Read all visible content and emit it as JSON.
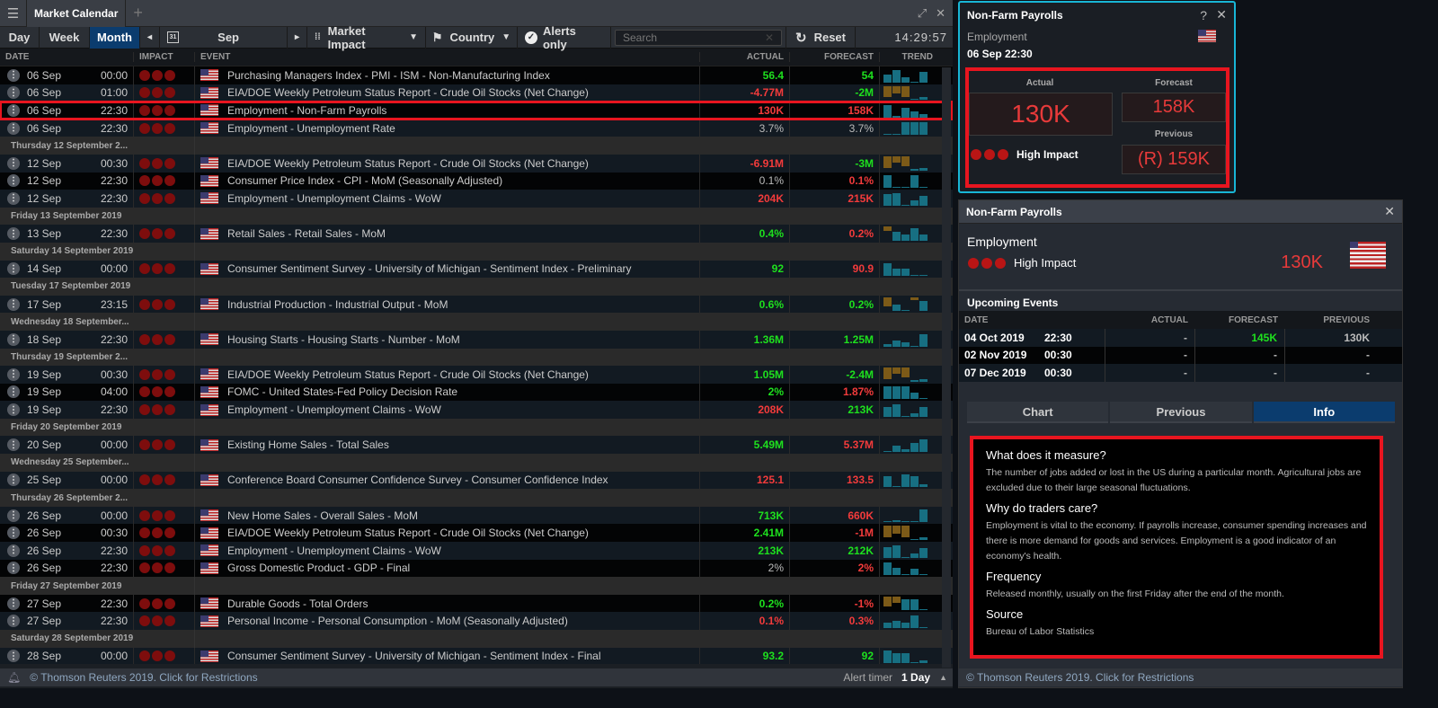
{
  "app": {
    "menu_icon": "hamburger-icon",
    "tab_title": "Market Calendar",
    "add_tab": "+",
    "expand_icon": "⤢",
    "close_icon": "✕"
  },
  "toolbar": {
    "views": [
      "Day",
      "Week",
      "Month"
    ],
    "active_view": "Month",
    "prev": "◂",
    "month": "Sep",
    "next": "▸",
    "impact_filter": "Market Impact",
    "country_filter": "Country",
    "alerts_only": "Alerts only",
    "search_placeholder": "Search",
    "reset": "Reset",
    "clock": "14:29:57"
  },
  "table": {
    "headers": {
      "date": "DATE",
      "impact": "IMPACT",
      "event": "EVENT",
      "actual": "ACTUAL",
      "forecast": "FORECAST",
      "trend": "TREND"
    },
    "rows": [
      {
        "type": "event",
        "date": "06 Sep",
        "time": "00:00",
        "event": "Purchasing Managers Index - PMI - ISM - Non-Manufacturing Index",
        "actual": "56.4",
        "actual_color": "green",
        "forecast": "54",
        "forecast_color": "green",
        "trend": [
          0.6,
          1,
          0.4,
          0.05,
          0.8
        ],
        "dark": true
      },
      {
        "type": "event",
        "date": "06 Sep",
        "time": "01:00",
        "event": "EIA/DOE Weekly Petroleum Status Report - Crude Oil Stocks (Net Change)",
        "actual": "-4.77M",
        "actual_color": "red",
        "forecast": "-2M",
        "forecast_color": "green",
        "trend": [
          -0.9,
          -0.6,
          -0.9,
          0.1,
          0.2
        ]
      },
      {
        "type": "event",
        "date": "06 Sep",
        "time": "22:30",
        "event": "Employment - Non-Farm Payrolls",
        "actual": "130K",
        "actual_color": "red",
        "forecast": "158K",
        "forecast_color": "red",
        "trend": [
          1,
          0.1,
          0.8,
          0.5,
          0.3
        ],
        "selected": true
      },
      {
        "type": "event",
        "date": "06 Sep",
        "time": "22:30",
        "event": "Employment - Unemployment Rate",
        "actual": "3.7%",
        "actual_color": "grey",
        "forecast": "3.7%",
        "forecast_color": "grey",
        "trend": [
          0.05,
          0.05,
          1,
          1,
          1
        ]
      },
      {
        "type": "group",
        "label": "Thursday 12 September 2..."
      },
      {
        "type": "event",
        "date": "12 Sep",
        "time": "00:30",
        "event": "EIA/DOE Weekly Petroleum Status Report - Crude Oil Stocks (Net Change)",
        "actual": "-6.91M",
        "actual_color": "red",
        "forecast": "-3M",
        "forecast_color": "green",
        "trend": [
          -0.9,
          -0.5,
          -0.8,
          0.1,
          0.2
        ]
      },
      {
        "type": "event",
        "date": "12 Sep",
        "time": "22:30",
        "event": "Consumer Price Index - CPI - MoM (Seasonally Adjusted)",
        "actual": "0.1%",
        "actual_color": "grey",
        "forecast": "0.1%",
        "forecast_color": "red",
        "trend": [
          1,
          0.05,
          0.05,
          1,
          0.05
        ],
        "dark": true
      },
      {
        "type": "event",
        "date": "12 Sep",
        "time": "22:30",
        "event": "Employment - Unemployment Claims - WoW",
        "actual": "204K",
        "actual_color": "red",
        "forecast": "215K",
        "forecast_color": "red",
        "trend": [
          0.9,
          1,
          0.05,
          0.4,
          0.8
        ]
      },
      {
        "type": "group",
        "label": "Friday 13 September 2019"
      },
      {
        "type": "event",
        "date": "13 Sep",
        "time": "22:30",
        "event": "Retail Sales - Retail Sales - MoM",
        "actual": "0.4%",
        "actual_color": "green",
        "forecast": "0.2%",
        "forecast_color": "red",
        "trend": [
          -0.3,
          0.7,
          0.5,
          1,
          0.5
        ]
      },
      {
        "type": "group",
        "label": "Saturday 14 September 2019"
      },
      {
        "type": "event",
        "date": "14 Sep",
        "time": "00:00",
        "event": "Consumer Sentiment Survey - University of Michigan - Sentiment Index - Preliminary",
        "actual": "92",
        "actual_color": "green",
        "forecast": "90.9",
        "forecast_color": "red",
        "trend": [
          1,
          0.6,
          0.6,
          0.05,
          0.05
        ]
      },
      {
        "type": "group",
        "label": "Tuesday 17 September 2019"
      },
      {
        "type": "event",
        "date": "17 Sep",
        "time": "23:15",
        "event": "Industrial Production - Industrial Output - MoM",
        "actual": "0.6%",
        "actual_color": "green",
        "forecast": "0.2%",
        "forecast_color": "green",
        "trend": [
          -0.7,
          0.5,
          0.05,
          -0.2,
          0.8
        ]
      },
      {
        "type": "group",
        "label": "Wednesday 18 September..."
      },
      {
        "type": "event",
        "date": "18 Sep",
        "time": "22:30",
        "event": "Housing Starts - Housing Starts - Number - MoM",
        "actual": "1.36M",
        "actual_color": "green",
        "forecast": "1.25M",
        "forecast_color": "green",
        "trend": [
          0.2,
          0.45,
          0.35,
          0.05,
          1
        ]
      },
      {
        "type": "group",
        "label": "Thursday 19 September 2..."
      },
      {
        "type": "event",
        "date": "19 Sep",
        "time": "00:30",
        "event": "EIA/DOE Weekly Petroleum Status Report - Crude Oil Stocks (Net Change)",
        "actual": "1.05M",
        "actual_color": "green",
        "forecast": "-2.4M",
        "forecast_color": "green",
        "trend": [
          -0.9,
          -0.5,
          -0.8,
          0.1,
          0.2
        ]
      },
      {
        "type": "event",
        "date": "19 Sep",
        "time": "04:00",
        "event": "FOMC - United States-Fed Policy Decision Rate",
        "actual": "2%",
        "actual_color": "green",
        "forecast": "1.87%",
        "forecast_color": "red",
        "trend": [
          1,
          1,
          1,
          0.5,
          0.05
        ],
        "dark": true
      },
      {
        "type": "event",
        "date": "19 Sep",
        "time": "22:30",
        "event": "Employment - Unemployment Claims - WoW",
        "actual": "208K",
        "actual_color": "red",
        "forecast": "213K",
        "forecast_color": "green",
        "trend": [
          0.8,
          1,
          0.05,
          0.3,
          0.75
        ]
      },
      {
        "type": "group",
        "label": "Friday 20 September 2019"
      },
      {
        "type": "event",
        "date": "20 Sep",
        "time": "00:00",
        "event": "Existing Home Sales - Total Sales",
        "actual": "5.49M",
        "actual_color": "green",
        "forecast": "5.37M",
        "forecast_color": "red",
        "trend": [
          0.05,
          0.5,
          0.25,
          0.7,
          1
        ]
      },
      {
        "type": "group",
        "label": "Wednesday 25 September..."
      },
      {
        "type": "event",
        "date": "25 Sep",
        "time": "00:00",
        "event": "Conference Board Consumer Confidence Survey - Consumer Confidence Index",
        "actual": "125.1",
        "actual_color": "red",
        "forecast": "133.5",
        "forecast_color": "red",
        "trend": [
          0.85,
          0.1,
          1,
          0.9,
          0.25
        ]
      },
      {
        "type": "group",
        "label": "Thursday 26 September 2..."
      },
      {
        "type": "event",
        "date": "26 Sep",
        "time": "00:00",
        "event": "New Home Sales - Overall Sales - MoM",
        "actual": "713K",
        "actual_color": "green",
        "forecast": "660K",
        "forecast_color": "red",
        "trend": [
          0.05,
          0.2,
          0.05,
          0.1,
          1
        ]
      },
      {
        "type": "event",
        "date": "26 Sep",
        "time": "00:30",
        "event": "EIA/DOE Weekly Petroleum Status Report - Crude Oil Stocks (Net Change)",
        "actual": "2.41M",
        "actual_color": "green",
        "forecast": "-1M",
        "forecast_color": "red",
        "trend": [
          -0.9,
          -0.6,
          -0.9,
          0.1,
          0.2
        ],
        "dark": true
      },
      {
        "type": "event",
        "date": "26 Sep",
        "time": "22:30",
        "event": "Employment - Unemployment Claims - WoW",
        "actual": "213K",
        "actual_color": "green",
        "forecast": "212K",
        "forecast_color": "green",
        "trend": [
          0.8,
          1,
          0.05,
          0.3,
          0.75
        ]
      },
      {
        "type": "event",
        "date": "26 Sep",
        "time": "22:30",
        "event": "Gross Domestic Product - GDP - Final",
        "actual": "2%",
        "actual_color": "grey",
        "forecast": "2%",
        "forecast_color": "red",
        "trend": [
          1,
          0.6,
          0.1,
          0.5,
          0.05
        ],
        "dark": true
      },
      {
        "type": "group",
        "label": "Friday 27 September 2019"
      },
      {
        "type": "event",
        "date": "27 Sep",
        "time": "22:30",
        "event": "Durable Goods - Total Orders",
        "actual": "0.2%",
        "actual_color": "green",
        "forecast": "-1%",
        "forecast_color": "red",
        "trend": [
          -0.8,
          -0.5,
          0.9,
          0.9,
          0.1
        ],
        "dark": true
      },
      {
        "type": "event",
        "date": "27 Sep",
        "time": "22:30",
        "event": "Personal Income - Personal Consumption - MoM (Seasonally Adjusted)",
        "actual": "0.1%",
        "actual_color": "red",
        "forecast": "0.3%",
        "forecast_color": "red",
        "trend": [
          0.4,
          0.6,
          0.4,
          1,
          0.05
        ]
      },
      {
        "type": "group",
        "label": "Saturday 28 September 2019"
      },
      {
        "type": "event",
        "date": "28 Sep",
        "time": "00:00",
        "event": "Consumer Sentiment Survey - University of Michigan - Sentiment Index - Final",
        "actual": "93.2",
        "actual_color": "green",
        "forecast": "92",
        "forecast_color": "green",
        "trend": [
          1,
          0.8,
          0.8,
          0.05,
          0.2
        ]
      }
    ]
  },
  "footer": {
    "copyright": "© Thomson Reuters 2019. Click for Restrictions",
    "alert_timer_label": "Alert timer",
    "alert_timer_value": "1 Day"
  },
  "popup": {
    "title": "Non-Farm Payrolls",
    "help": "?",
    "close": "✕",
    "category": "Employment",
    "datetime": "06 Sep 22:30",
    "actual_label": "Actual",
    "actual": "130K",
    "forecast_label": "Forecast",
    "forecast": "158K",
    "previous_label": "Previous",
    "previous": "(R) 159K",
    "impact": "High Impact"
  },
  "detail": {
    "title": "Non-Farm Payrolls",
    "close": "✕",
    "category": "Employment",
    "impact": "High Impact",
    "actual": "130K",
    "upcoming_title": "Upcoming Events",
    "upcoming_headers": {
      "date": "DATE",
      "actual": "ACTUAL",
      "forecast": "FORECAST",
      "previous": "PREVIOUS"
    },
    "upcoming": [
      {
        "date": "04 Oct 2019",
        "time": "22:30",
        "actual": "-",
        "forecast": "145K",
        "previous": "130K"
      },
      {
        "date": "02 Nov 2019",
        "time": "00:30",
        "actual": "-",
        "forecast": "-",
        "previous": "-"
      },
      {
        "date": "07 Dec 2019",
        "time": "00:30",
        "actual": "-",
        "forecast": "-",
        "previous": "-"
      }
    ],
    "tabs": [
      "Chart",
      "Previous",
      "Info"
    ],
    "active_tab": "Info",
    "info": [
      {
        "heading": "What does it measure?",
        "text": "The number of jobs added or lost in the US during a particular month. Agricultural jobs are excluded due to their large seasonal fluctuations."
      },
      {
        "heading": "Why do traders care?",
        "text": "Employment is vital to the economy. If payrolls increase, consumer spending increases and there is more demand for goods and services. Employment is a good indicator of an economy's health."
      },
      {
        "heading": "Frequency",
        "text": "Released monthly, usually on the first Friday after the end of the month."
      },
      {
        "heading": "Source",
        "text": "Bureau of Labor Statistics"
      }
    ],
    "footer": "© Thomson Reuters 2019. Click for Restrictions"
  },
  "colors": {
    "green": "#1ee01e",
    "red": "#f33b3b",
    "accent": "#0b3c6e",
    "highlight": "#e8151f",
    "popup_border": "#18b6d6"
  }
}
